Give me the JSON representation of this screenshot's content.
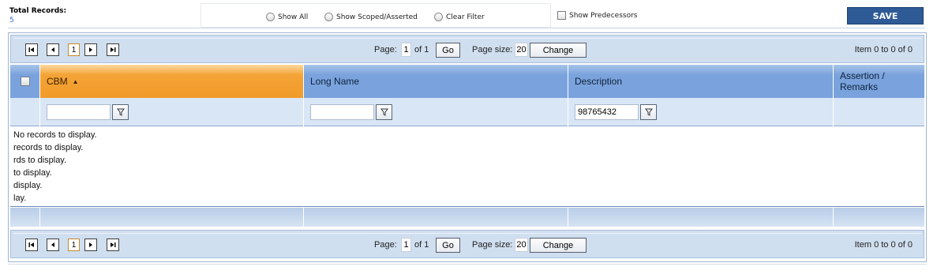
{
  "header": {
    "total_records_label": "Total Records:",
    "total_records_value": "5",
    "filter_options": [
      {
        "label": "Show All",
        "selected": false
      },
      {
        "label": "Show Scoped/Asserted",
        "selected": false
      },
      {
        "label": "Clear Filter",
        "selected": false
      }
    ],
    "show_predecessors_label": "Show Predecessors",
    "show_predecessors_checked": false,
    "save_label": "SAVE"
  },
  "pager": {
    "first_icon": "first-page-icon",
    "prev_icon": "prev-page-icon",
    "next_icon": "next-page-icon",
    "last_icon": "last-page-icon",
    "current_page_link": "1",
    "page_label": "Page:",
    "page_value": "1",
    "of_label": "of 1",
    "go_label": "Go",
    "page_size_label": "Page size:",
    "page_size_value": "20",
    "change_label": "Change",
    "item_info": "Item 0 to 0 of 0"
  },
  "grid": {
    "columns": [
      {
        "label": "CBM",
        "sorted": "asc"
      },
      {
        "label": "Long Name"
      },
      {
        "label": "Description"
      },
      {
        "label": "Assertion / Remarks"
      }
    ],
    "filters": {
      "cbm": "",
      "long_name": "",
      "description": "98765432"
    },
    "empty_messages": [
      "No records to display.",
      "records to display.",
      "rds to display.",
      "to display.",
      "display.",
      "lay."
    ]
  },
  "colors": {
    "accent": "#2e5a96",
    "header_blue": "#7aa3dd",
    "sorted_orange": "#f29a2a",
    "pager_bg": "#d0dff0"
  }
}
